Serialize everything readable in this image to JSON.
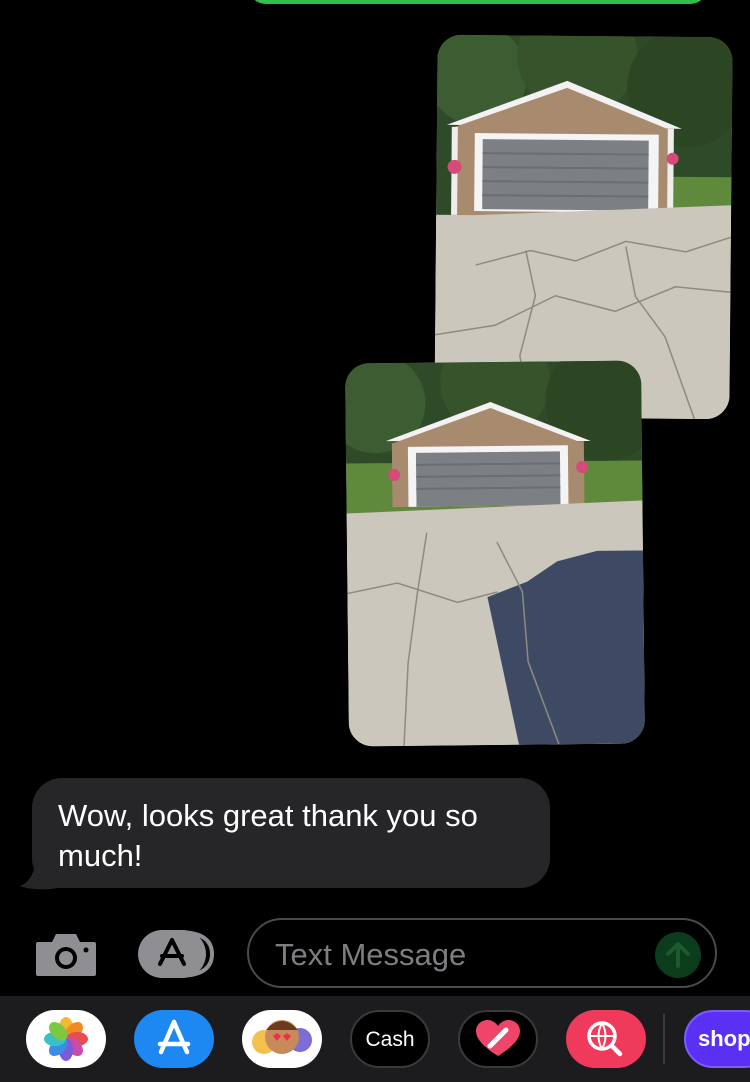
{
  "conversation": {
    "messages": [
      {
        "direction": "outgoing",
        "type": "photo",
        "subject": "garage-and-driveway-1"
      },
      {
        "direction": "outgoing",
        "type": "photo",
        "subject": "garage-and-driveway-2"
      },
      {
        "direction": "incoming",
        "type": "text",
        "text": "Wow, looks great thank you so much!"
      }
    ]
  },
  "compose": {
    "placeholder": "Text Message",
    "camera_icon": "camera-icon",
    "apps_icon": "app-store-icon",
    "send_icon": "arrow-up-icon"
  },
  "app_drawer": {
    "apps": [
      {
        "name": "Photos",
        "icon": "photos-icon"
      },
      {
        "name": "App Store",
        "icon": "app-store-icon"
      },
      {
        "name": "Memoji",
        "icon": "memoji-icon"
      },
      {
        "name": "Apple Cash",
        "label": "Cash",
        "icon": "apple-cash-icon"
      },
      {
        "name": "Fitness",
        "icon": "heart-icon"
      },
      {
        "name": "Images",
        "icon": "globe-search-icon"
      },
      {
        "name": "Shop",
        "label": "shop",
        "icon": "shop-icon"
      }
    ]
  },
  "colors": {
    "background": "#000000",
    "incoming_bubble": "#262628",
    "imessage_green": "#30c048",
    "drawer": "#1c1c1e"
  }
}
